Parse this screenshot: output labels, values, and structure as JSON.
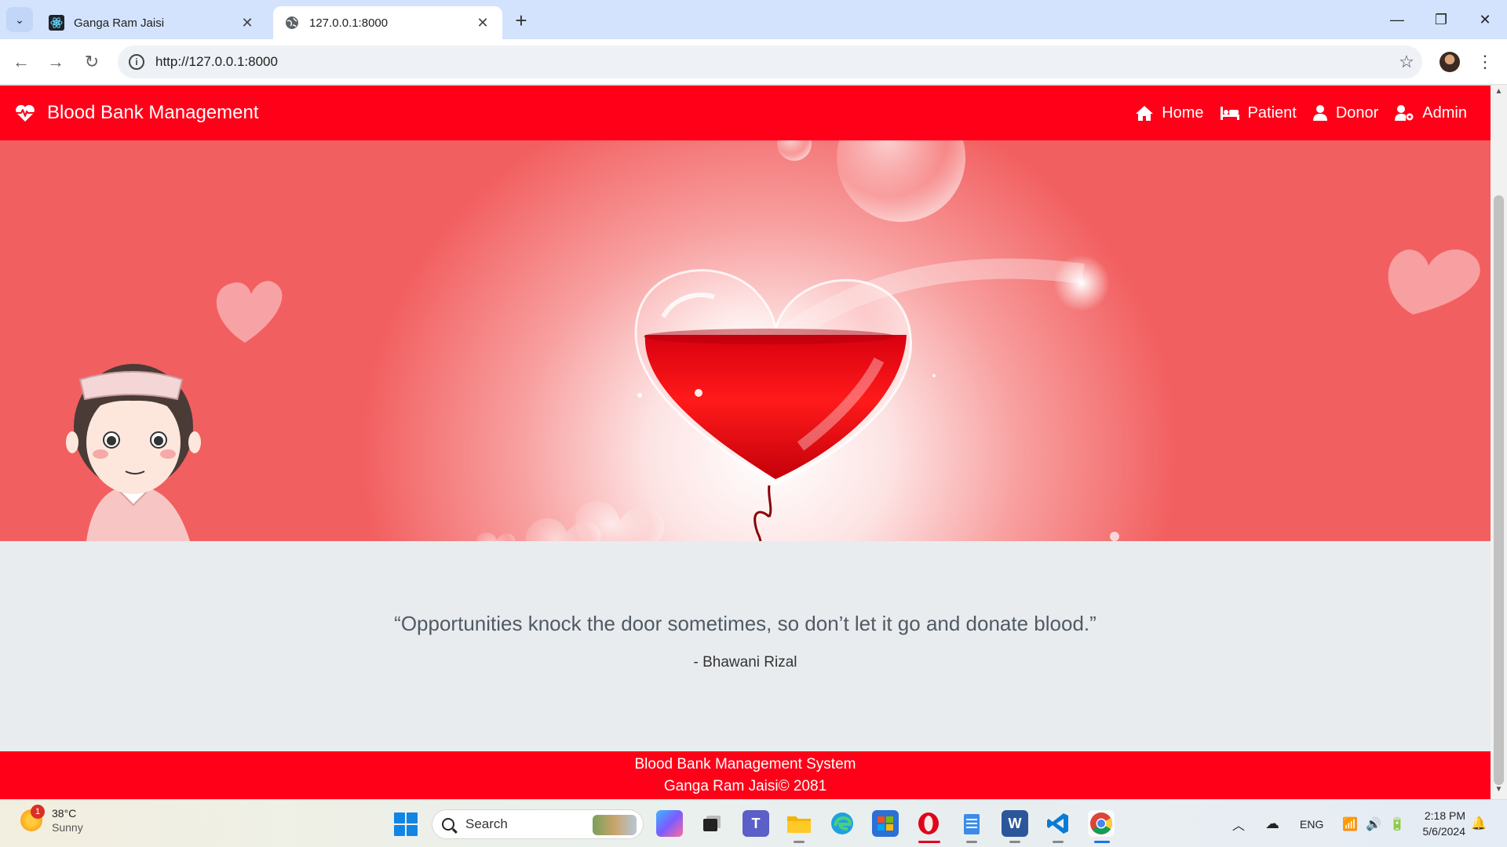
{
  "browser": {
    "tabs": [
      {
        "title": "Ganga Ram Jaisi",
        "favicon": "react-icon",
        "active": false
      },
      {
        "title": "127.0.0.1:8000",
        "favicon": "globe-icon",
        "active": true
      }
    ],
    "url": "http://127.0.0.1:8000"
  },
  "navbar": {
    "brand": "Blood Bank Management",
    "links": [
      {
        "label": "Home",
        "icon": "home-icon"
      },
      {
        "label": "Patient",
        "icon": "bed-icon"
      },
      {
        "label": "Donor",
        "icon": "user-icon"
      },
      {
        "label": "Admin",
        "icon": "user-cog-icon"
      }
    ],
    "color": "#ff0018"
  },
  "quote": {
    "text": "“Opportunities knock the door sometimes, so don’t let it go and donate blood.”",
    "author": "- Bhawani Rizal"
  },
  "footer": {
    "line1": "Blood Bank Management System",
    "line2": "Ganga Ram Jaisi© 2081"
  },
  "taskbar": {
    "weather": {
      "temp": "38°C",
      "condition": "Sunny",
      "badge": "1"
    },
    "search_placeholder": "Search",
    "tray": {
      "language": "ENG"
    },
    "clock": {
      "time": "2:18 PM",
      "date": "5/6/2024"
    }
  }
}
